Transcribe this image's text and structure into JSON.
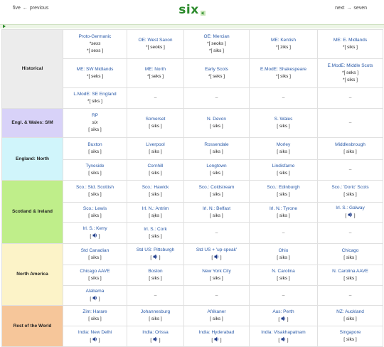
{
  "header": {
    "prev_label": "five",
    "prev_arrow": "←",
    "prev_text": "previous",
    "title": "six",
    "next_text": "next",
    "next_arrow": "→",
    "next_label": "seven"
  },
  "rows": [
    {
      "region": "Historical",
      "region_class": "bg-hist",
      "height": 41,
      "cells": [
        {
          "place": "Proto-Germanic",
          "word": "*sexs",
          "ipa": "*[ sexs ]"
        },
        {
          "place": "OE: West Saxon",
          "ipa": "*[ seoks ]"
        },
        {
          "place": "OE: Mercian",
          "ipa": "*[ seoks ]",
          "ipa2": "*[ siks ]"
        },
        {
          "place": "ME: Kentish",
          "ipa": "*[ ziks ]"
        },
        {
          "place": "ME: E. Midlands",
          "ipa": "*[ siks ]"
        }
      ]
    },
    {
      "height": 41,
      "cells": [
        {
          "place": "ME: SW Midlands",
          "ipa": "*[ seks ]"
        },
        {
          "place": "ME: North",
          "ipa": "*[ seks ]"
        },
        {
          "place": "Early Scots",
          "ipa": "*[ seks ]"
        },
        {
          "place": "E.ModE: Shakespeare",
          "ipa": "*[ siks ]"
        },
        {
          "place": "E.ModE: Middle Scots",
          "ipa": "*[ seks ]",
          "ipa2": "*[ siks ]"
        }
      ]
    },
    {
      "height": 29,
      "cells": [
        {
          "place": "L.ModE: SE England",
          "ipa": "*[ siks ]"
        },
        {
          "dash": "–"
        },
        {
          "dash": "–"
        },
        {
          "dash": "–"
        },
        {
          "dash": "–"
        }
      ]
    },
    {
      "region": "Engl. & Wales: S/M",
      "region_class": "bg-engw",
      "height": 41,
      "cells": [
        {
          "place": "RP",
          "word": "six",
          "ipa": "[ siks ]"
        },
        {
          "place": "Somerset",
          "ipa": "[ siks ]"
        },
        {
          "place": "N. Devon",
          "ipa": "[ siks ]"
        },
        {
          "place": "S. Wales",
          "ipa": "[ siks ]"
        },
        {
          "dash": "–"
        }
      ]
    },
    {
      "region": "England: North",
      "region_class": "bg-engn",
      "height": 31,
      "cells": [
        {
          "place": "Buxton",
          "ipa": "[ siks ]"
        },
        {
          "place": "Liverpool",
          "ipa": "[ siks ]"
        },
        {
          "place": "Rossendale",
          "ipa": "[ siks ]"
        },
        {
          "place": "Morley",
          "ipa": "[ siks ]"
        },
        {
          "place": "Middlesbrough",
          "ipa": "[ siks ]"
        }
      ]
    },
    {
      "height": 29,
      "cells": [
        {
          "place": "Tyneside",
          "ipa": "[ siks ]"
        },
        {
          "place": "Cornhill",
          "ipa": "[ siks ]"
        },
        {
          "place": "Longtown",
          "ipa": "[ siks ]"
        },
        {
          "place": "Lindisfarne",
          "ipa": "[ siks ]"
        },
        {
          "dash": "–"
        }
      ]
    },
    {
      "region": "Scotland & Ireland",
      "region_class": "bg-scot",
      "height": 31,
      "cells": [
        {
          "place": "Sco.: Std. Scottish",
          "ipa": "[ siks ]"
        },
        {
          "place": "Sco.: Hawick",
          "ipa": "[ siks ]"
        },
        {
          "place": "Sco.: Coldstream",
          "ipa": "[ siks ]"
        },
        {
          "place": "Sco.: Edinburgh",
          "ipa": "[ siks ]"
        },
        {
          "place": "Sco.: 'Doric' Scots",
          "ipa": "[ siks ]"
        }
      ]
    },
    {
      "height": 28,
      "cells": [
        {
          "place": "Sco.: Lewis",
          "ipa": "[ siks ]"
        },
        {
          "place": "Irl. N.: Antrim",
          "ipa": "[ sɨ̞ks ]"
        },
        {
          "place": "Irl. N.: Belfast",
          "ipa": "[ siks ]"
        },
        {
          "place": "Irl. N.: Tyrone",
          "ipa": "[ siks ]"
        },
        {
          "place": "Irl. S.: Galway",
          "listen": true
        }
      ]
    },
    {
      "height": 30,
      "cells": [
        {
          "place": "Irl. S.: Kerry",
          "listen": true
        },
        {
          "place": "Irl. S.: Cork",
          "ipa": "[ siks ]"
        },
        {
          "dash": "–"
        },
        {
          "dash": "–"
        },
        {
          "dash": "–"
        }
      ]
    },
    {
      "region": "North America",
      "region_class": "bg-na",
      "height": 30,
      "cells": [
        {
          "place": "Std Canadian",
          "ipa": "[ siks ]"
        },
        {
          "place": "Std US: Pittsburgh",
          "listen": true
        },
        {
          "place": "Std US + 'up-speak'",
          "listen": true
        },
        {
          "place": "Ohio",
          "ipa": "[ siks ]"
        },
        {
          "place": "Chicago",
          "ipa": "[ siks ]"
        }
      ]
    },
    {
      "height": 29,
      "cells": [
        {
          "place": "Chicago AAVE",
          "ipa": "[ siks ]"
        },
        {
          "place": "Boston",
          "ipa": "[ siks ]"
        },
        {
          "place": "New York City",
          "ipa": "[ siks ]"
        },
        {
          "place": "N. Carolina",
          "ipa": "[ siks ]"
        },
        {
          "place": "N. Carolina AAVE",
          "ipa": "[ siks ]"
        }
      ]
    },
    {
      "height": 28,
      "cells": [
        {
          "place": "Alabama",
          "listen": true
        },
        {
          "dash": "–"
        },
        {
          "dash": "–"
        },
        {
          "dash": "–"
        },
        {
          "dash": "–"
        }
      ]
    },
    {
      "region": "Rest of the World",
      "region_class": "bg-rest",
      "height": 29,
      "cells": [
        {
          "place": "Zim: Harare",
          "ipa": "[ siks ]"
        },
        {
          "place": "Johannesburg",
          "ipa": "[ siks ]"
        },
        {
          "place": "Afrikaner",
          "ipa": "[ siks ]"
        },
        {
          "place": "Aus: Perth",
          "listen": true
        },
        {
          "place": "NZ: Auckland",
          "ipa": "[ siks ]"
        }
      ]
    },
    {
      "height": 29,
      "cells": [
        {
          "place": "India: New Delhi",
          "listen": true
        },
        {
          "place": "India: Orissa",
          "listen": true
        },
        {
          "place": "India: Hyderabad",
          "listen": true
        },
        {
          "place": "India: Visakhapatnam",
          "listen": true
        },
        {
          "place": "Singapore",
          "ipa": "[ siks ]"
        }
      ]
    }
  ]
}
